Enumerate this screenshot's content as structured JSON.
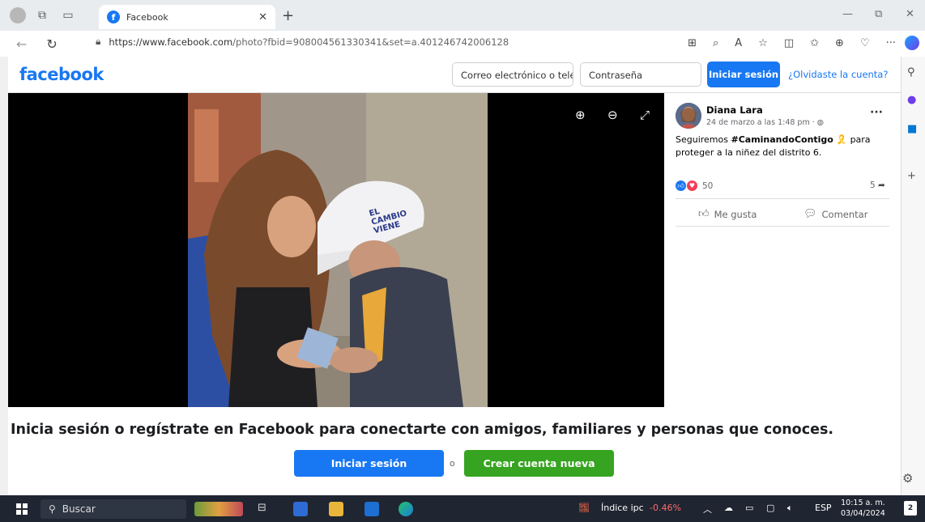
{
  "browser": {
    "tab_title": "Facebook",
    "url_main": "https://www.facebook.com",
    "url_rest": "/photo?fbid=908004561330341&set=a.401246742006128"
  },
  "fb_header": {
    "logo": "facebook",
    "email_placeholder": "Correo electrónico o telé",
    "password_placeholder": "Contraseña",
    "login_label": "Iniciar sesión",
    "forgot_label": "¿Olvidaste la cuenta?"
  },
  "post": {
    "author": "Diana Lara",
    "date": "24 de marzo a las 1:48 pm · ",
    "text_before": "Seguiremos ",
    "hashtag": "#CaminandoContigo",
    "text_after": " 🎗️ para proteger a la niñez del distrito 6.",
    "reactions_count": "50",
    "shares_count": "5",
    "like_label": "Me gusta",
    "comment_label": "Comentar",
    "cap_text_1": "EL",
    "cap_text_2": "CAMBIO",
    "cap_text_3": "VIENE"
  },
  "banner": {
    "text": "Inicia sesión o regístrate en Facebook para conectarte con amigos, familiares y personas que conoces.",
    "login_label": "Iniciar sesión",
    "or_label": "o",
    "create_label": "Crear cuenta nueva"
  },
  "taskbar": {
    "search_label": "Buscar",
    "stock_label": "Índice ipc",
    "stock_change": "-0.46%",
    "lang": "ESP",
    "time": "10:15 a. m.",
    "date": "03/04/2024",
    "notif_count": "2"
  },
  "colors": {
    "fb_blue": "#1877f2",
    "fb_green": "#36a420",
    "stock_red": "#ff6b6b"
  }
}
